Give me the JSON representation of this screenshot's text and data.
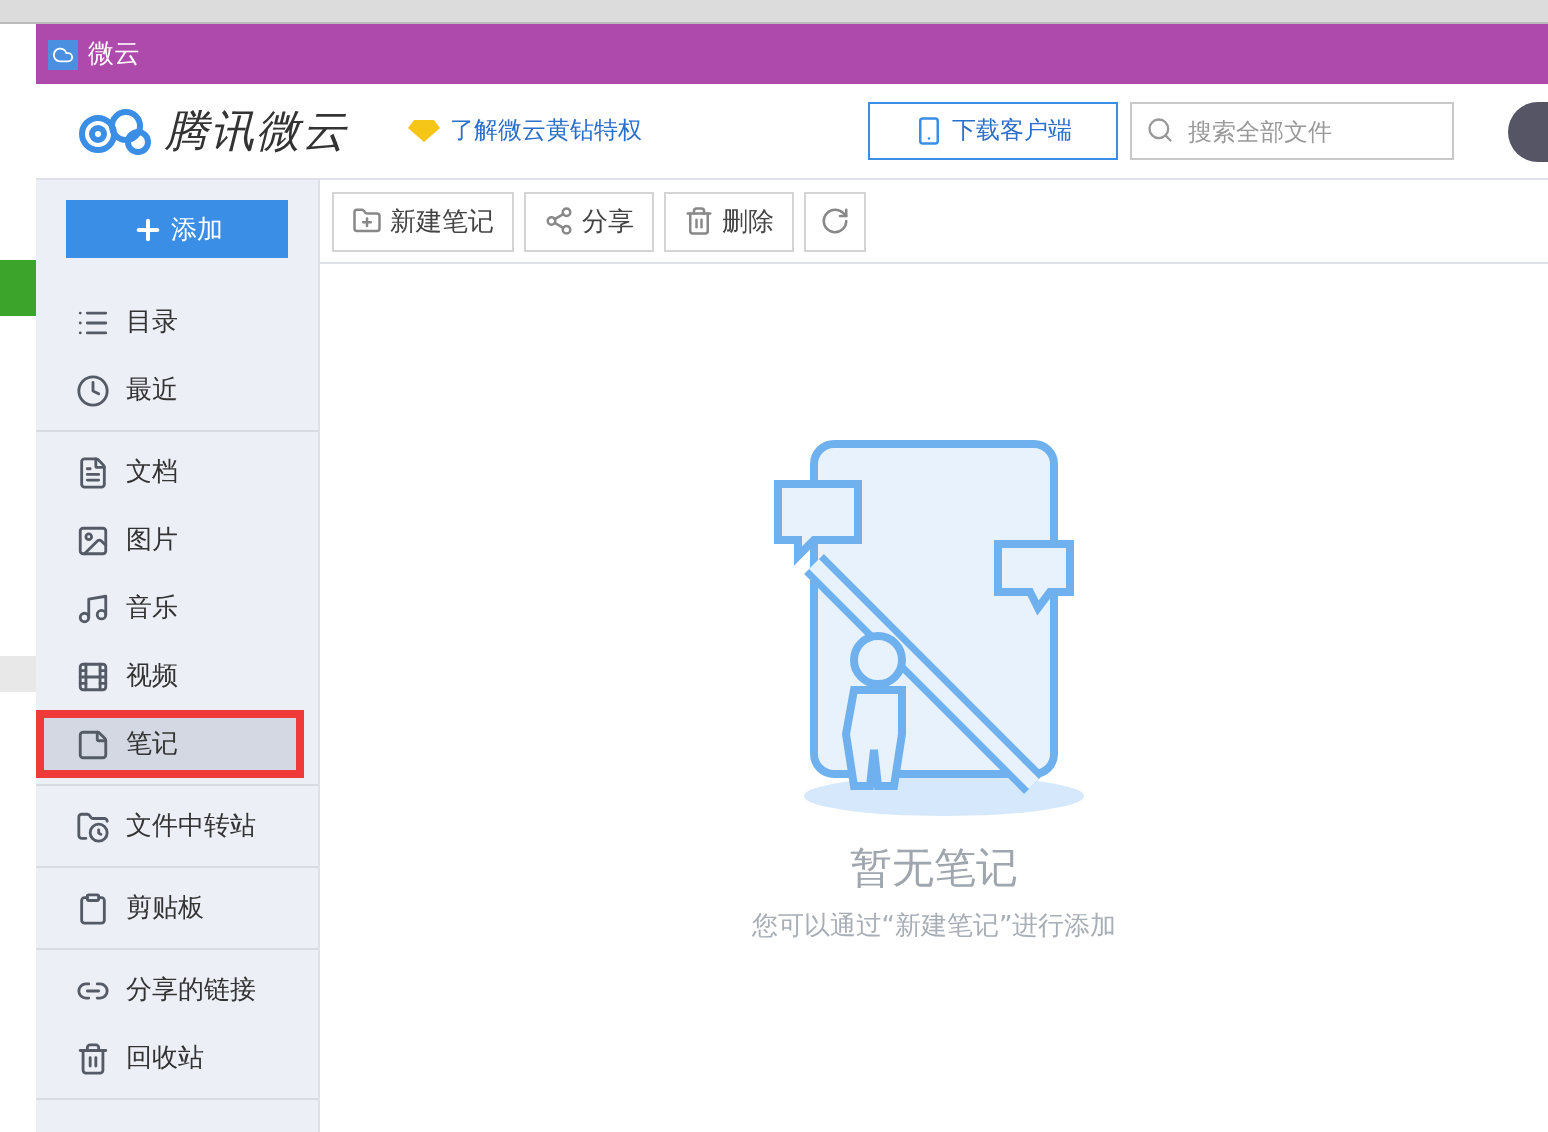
{
  "window": {
    "title": "微云"
  },
  "header": {
    "logo": "腾讯微云",
    "promo_link": "了解微云黄钻特权",
    "download_button": "下载客户端",
    "search": {
      "placeholder": "搜索全部文件"
    }
  },
  "sidebar": {
    "add_button": "添加",
    "groups": [
      [
        {
          "label": "目录",
          "selected": false,
          "marked": false
        },
        {
          "label": "最近",
          "selected": false,
          "marked": false
        }
      ],
      [
        {
          "label": "文档",
          "selected": false,
          "marked": false
        },
        {
          "label": "图片",
          "selected": false,
          "marked": false
        },
        {
          "label": "音乐",
          "selected": false,
          "marked": false
        },
        {
          "label": "视频",
          "selected": false,
          "marked": false
        },
        {
          "label": "笔记",
          "selected": true,
          "marked": true
        }
      ],
      [
        {
          "label": "文件中转站",
          "selected": false,
          "marked": false
        }
      ],
      [
        {
          "label": "剪贴板",
          "selected": false,
          "marked": false
        }
      ],
      [
        {
          "label": "分享的链接",
          "selected": false,
          "marked": false
        },
        {
          "label": "回收站",
          "selected": false,
          "marked": false
        }
      ]
    ]
  },
  "toolbar": {
    "buttons": [
      "新建笔记",
      "分享",
      "删除"
    ]
  },
  "empty_state": {
    "title": "暂无笔记",
    "hint": "您可以通过“新建笔记”进行添加"
  }
}
